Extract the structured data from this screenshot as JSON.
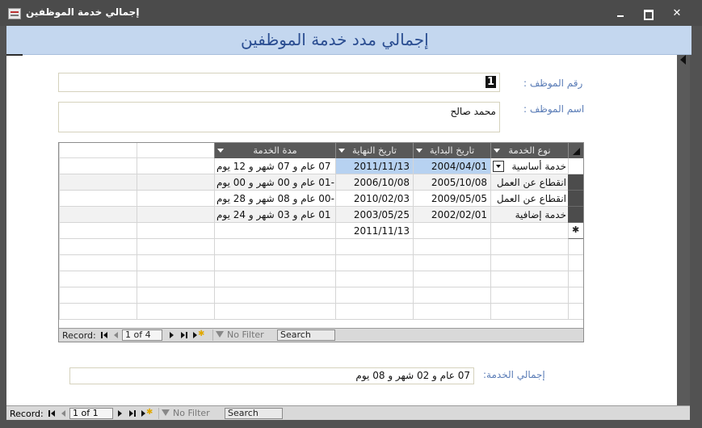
{
  "window": {
    "title": "إجمالي خدمة الموظفين"
  },
  "form": {
    "heading": "إجمالي مدد خدمة الموظفين"
  },
  "employee": {
    "id_label": "رقم الموظف :",
    "id_value": "1",
    "name_label": "اسم الموظف :",
    "name_value": "محمد صالح"
  },
  "subform": {
    "columns": [
      "نوع الخدمة",
      "تاريخ البداية",
      "تاريخ النهاية",
      "مدة الخدمة"
    ],
    "rows": [
      {
        "type": "خدمة أساسية",
        "start": "2004/04/01",
        "end": "2011/11/13",
        "duration": "07 عام و 07 شهر و 12 يوم"
      },
      {
        "type": "انقطاع عن العمل",
        "start": "2005/10/08",
        "end": "2006/10/08",
        "duration": "-01 عام و 00 شهر و 00 يوم"
      },
      {
        "type": "انقطاع عن العمل",
        "start": "2009/05/05",
        "end": "2010/02/03",
        "duration": "-00 عام و 08 شهر و 28 يوم"
      },
      {
        "type": "خدمة إضافية",
        "start": "2002/02/01",
        "end": "2003/05/25",
        "duration": "01 عام و 03 شهر و 24 يوم"
      }
    ],
    "new_row": {
      "end": "2011/11/13"
    },
    "nav": {
      "record_label": "Record:",
      "position": "1 of 4",
      "filter_label": "No Filter",
      "search_label": "Search"
    }
  },
  "total": {
    "label": "إجمالي الخدمة:",
    "value": "07 عام و 02 شهر و 08 يوم"
  },
  "main_nav": {
    "record_label": "Record:",
    "position": "1 of 1",
    "filter_label": "No Filter",
    "search_label": "Search"
  }
}
